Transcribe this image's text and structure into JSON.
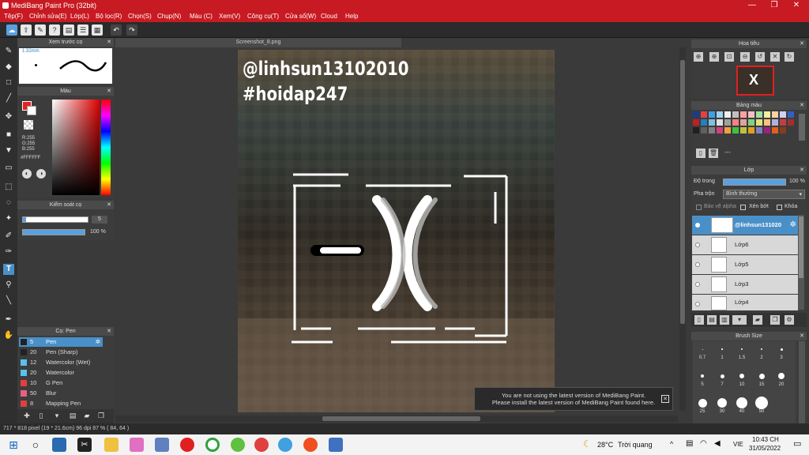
{
  "window": {
    "title": "MediBang Paint Pro (32bit)",
    "min": "—",
    "max": "❐",
    "close": "✕"
  },
  "menu": [
    "Tệp(F)",
    "Chỉnh sửa(E)",
    "Lớp(L)",
    "Bộ lọc(R)",
    "Chọn(S)",
    "Chụp(N)",
    "Màu (C)",
    "Xem(V)",
    "Công cụ(T)",
    "Cửa sổ(W)",
    "Cloud",
    "Help"
  ],
  "preview_panel": {
    "title": "Xem trước cọ",
    "size": "1.32mm"
  },
  "color_panel": {
    "title": "Màu",
    "r": "R:255",
    "g": "G:255",
    "b": "B:255",
    "hex": "#FFFFFF"
  },
  "brush_control": {
    "title": "Kiểm soát cọ",
    "size_value": "5",
    "opacity_value": "100 %"
  },
  "brush_list": {
    "title": "Cọ: Pen",
    "items": [
      {
        "size": "5",
        "name": "Pen",
        "color": "#222222"
      },
      {
        "size": "20",
        "name": "Pen (Sharp)",
        "color": "#222222"
      },
      {
        "size": "12",
        "name": "Watercolor (Wet)",
        "color": "#5bc0eb"
      },
      {
        "size": "20",
        "name": "Watercolor",
        "color": "#5bc0eb"
      },
      {
        "size": "10",
        "name": "G Pen",
        "color": "#e04040"
      },
      {
        "size": "50",
        "name": "Blur",
        "color": "#e86080"
      },
      {
        "size": "8",
        "name": "Mapping Pen",
        "color": "#e04040"
      }
    ]
  },
  "document": {
    "tab": "Screenshot_8.png"
  },
  "canvas_text": {
    "line1": "@linhsun13102010",
    "line2": "#hoidap247"
  },
  "navigator": {
    "title": "Hoa tiêu"
  },
  "palette": {
    "title": "Bảng màu",
    "dots": "---",
    "colors": [
      "#1a3c8c",
      "#e84040",
      "#40a0e0",
      "#a0d0f0",
      "#f0f0f0",
      "#c0c0c0",
      "#ffa0a0",
      "#f0c0c0",
      "#a0e0a0",
      "#f0f0a0",
      "#ffd0a0",
      "#d0d0f0",
      "#3060c0",
      "#c02020",
      "#2080c0",
      "#80c0e0",
      "#e0e0e0",
      "#a0a0a0",
      "#ff8080",
      "#e0a0a0",
      "#80d080",
      "#e0e080",
      "#ffc080",
      "#b0b0e0",
      "#c04040",
      "#a03030",
      "#202020",
      "#606060",
      "#808080",
      "#d04080",
      "#f0a040",
      "#40c040",
      "#c0c040",
      "#e0a020",
      "#8080c0",
      "#a02080",
      "#e06020",
      "#804020"
    ]
  },
  "layers": {
    "title": "Lớp",
    "opacity_label": "Độ trong",
    "opacity_value": "100 %",
    "blend_label": "Pha trộn",
    "blend_value": "Bình thường",
    "protect_alpha": "Bảo vệ alpha",
    "clipping": "Xén bớt",
    "lock": "Khóa",
    "items": [
      "@linhsun131020",
      "Lớp6",
      "Lớp5",
      "Lớp3",
      "Lớp4"
    ]
  },
  "brush_size": {
    "title": "Brush Size",
    "labels": [
      "0.7",
      "1",
      "1.5",
      "2",
      "3",
      "5",
      "7",
      "10",
      "15",
      "20",
      "25",
      "30",
      "40",
      "50"
    ]
  },
  "notification": {
    "line1": "You are not using the latest version of MediBang Paint.",
    "line2": "Please install the latest version of MediBang Paint found here."
  },
  "status": {
    "text": "717 * 818 pixel  (19 * 21.6cm)  96 dpi  87 %  ( 84, 64 )"
  },
  "taskbar": {
    "weather_temp": "28°C",
    "weather_desc": "Trời quang",
    "lang": "VIE",
    "time": "10:43 CH",
    "date": "31/05/2022"
  }
}
